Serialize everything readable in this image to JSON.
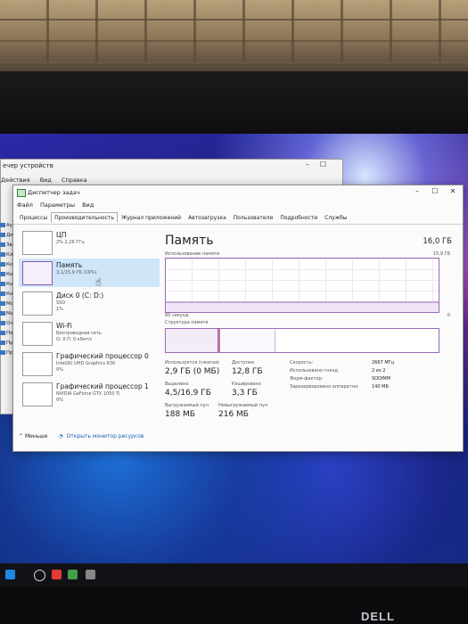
{
  "device_manager": {
    "title": "ечер устройств",
    "menu": [
      "Действия",
      "Вид",
      "Справка"
    ],
    "tree_items": [
      "Ауди",
      "Диск",
      "Звук",
      "Клав",
      "Комп",
      "Конт",
      "Конт",
      "Конт",
      "Мон",
      "Мыш",
      "Очер",
      "Порт",
      "Прог",
      "Проц"
    ]
  },
  "task_manager": {
    "title": "Диспетчер задач",
    "window_buttons": {
      "minimize": "–",
      "maximize": "☐",
      "close": "✕"
    },
    "menu": [
      "Файл",
      "Параметры",
      "Вид"
    ],
    "tabs": [
      "Процессы",
      "Производительность",
      "Журнал приложений",
      "Автозагрузка",
      "Пользователи",
      "Подробности",
      "Службы"
    ],
    "active_tab": "Производительность",
    "resources": [
      {
        "name": "ЦП",
        "line1": "2% 2,26 ГГц",
        "line2": ""
      },
      {
        "name": "Память",
        "line1": "3,1/15,9 ГБ (19%)",
        "line2": "",
        "selected": true
      },
      {
        "name": "Диск 0 (C: D:)",
        "line1": "SSD",
        "line2": "1%"
      },
      {
        "name": "Wi-Fi",
        "line1": "Беспроводная сеть",
        "line2": "О: 0 П: 0 кбит/с"
      },
      {
        "name": "Графический процессор 0",
        "line1": "Intel(R) UHD Graphics 630",
        "line2": "0%"
      },
      {
        "name": "Графический процессор 1",
        "line1": "NVIDIA GeForce GTX 1050 Ti",
        "line2": "0%"
      }
    ],
    "memory": {
      "title": "Память",
      "total": "16,0 ГБ",
      "graph_label": "Использование памяти",
      "graph_max": "15,9 ГБ",
      "graph_time": "60 секунд",
      "graph_min": "0",
      "composition_label": "Структура памяти",
      "usage_fraction": 0.19,
      "composition": {
        "in_use_fraction": 0.19,
        "modified_fraction": 0.01,
        "standby_fraction": 0.2
      },
      "stats": {
        "in_use_label": "Используется (сжатая)",
        "in_use_value": "2,9 ГБ (0 МБ)",
        "available_label": "Доступно",
        "available_value": "12,8 ГБ",
        "committed_label": "Выделено",
        "committed_value": "4,5/16,9 ГБ",
        "cached_label": "Кэшировано",
        "cached_value": "3,3 ГБ",
        "paged_label": "Выгружаемый пул",
        "paged_value": "188 МБ",
        "nonpaged_label": "Невыгружаемый пул",
        "nonpaged_value": "216 МБ"
      },
      "specs": {
        "speed_label": "Скорость:",
        "speed_value": "2667 МГц",
        "slots_label": "Использовано гнезд:",
        "slots_value": "2 из 2",
        "form_label": "Форм-фактор:",
        "form_value": "SODIMM",
        "reserved_label": "Зарезервировано аппаратно:",
        "reserved_value": "140 МБ"
      }
    },
    "footer": {
      "less": "Меньше",
      "monitor": "Открыть монитор ресурсов"
    }
  },
  "monitor_brand": "DELL",
  "colors": {
    "accent": "#9b6bb5",
    "selected": "#cfe6f8",
    "link": "#1a5fb4"
  }
}
